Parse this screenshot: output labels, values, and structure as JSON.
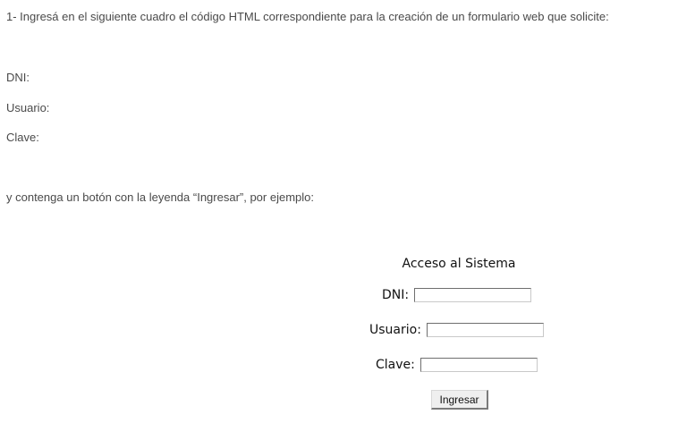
{
  "instructions": {
    "intro": "1- Ingresá en el siguiente cuadro el código HTML correspondiente para la creación de un formulario web que solicite:",
    "fields": [
      "DNI:",
      "Usuario:",
      "Clave:"
    ],
    "closing": "y contenga un botón con la leyenda “Ingresar”, por ejemplo:"
  },
  "example_form": {
    "title": "Acceso al Sistema",
    "dni_label": "DNI:",
    "usuario_label": "Usuario:",
    "clave_label": "Clave:",
    "dni_value": "",
    "usuario_value": "",
    "clave_value": "",
    "submit_label": "Ingresar"
  }
}
